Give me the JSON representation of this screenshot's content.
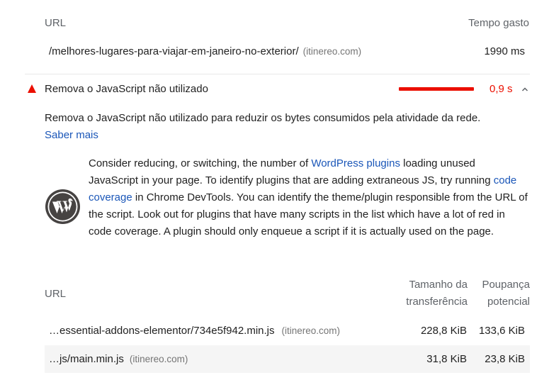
{
  "top_table": {
    "col_url": "URL",
    "col_time": "Tempo gasto",
    "row": {
      "url": "/melhores-lugares-para-viajar-em-janeiro-no-exterior/",
      "host": "(itinereo.com)",
      "time": "1990 ms"
    }
  },
  "audit": {
    "title": "Remova o JavaScript não utilizado",
    "savings": "0,9 s",
    "savings_color": "#eb0f00",
    "status_icon": "warning-triangle-icon",
    "toggle_icon": "chevron-up-icon",
    "description": "Remova o JavaScript não utilizado para reduzir os bytes consumidos pela atividade da rede.",
    "learn_more": "Saber mais"
  },
  "stack_pack": {
    "logo_icon": "wordpress-logo-icon",
    "text_1": "Consider reducing, or switching, the number of ",
    "link_1": "WordPress plugins",
    "text_2": " loading unused JavaScript in your page. To identify plugins that are adding extraneous JS, try running ",
    "link_2": "code coverage",
    "text_3": " in Chrome DevTools. You can identify the theme/plugin responsible from the URL of the script. Look out for plugins that have many scripts in the list which have a lot of red in code coverage. A plugin should only enqueue a script if it is actually used on the page."
  },
  "details_table": {
    "col_url": "URL",
    "col_transfer": "Tamanho da transferência",
    "col_savings": "Poupança potencial",
    "rows": [
      {
        "url": "…essential-addons-elementor/734e5f942.min.js",
        "host": "(itinereo.com)",
        "transfer": "228,8 KiB",
        "savings": "133,6 KiB"
      },
      {
        "url": "…js/main.min.js",
        "host": "(itinereo.com)",
        "transfer": "31,8 KiB",
        "savings": "23,8 KiB"
      }
    ]
  },
  "colors": {
    "link": "#1a56b8",
    "fail": "#eb0f00",
    "zebra": "#f5f5f5"
  }
}
